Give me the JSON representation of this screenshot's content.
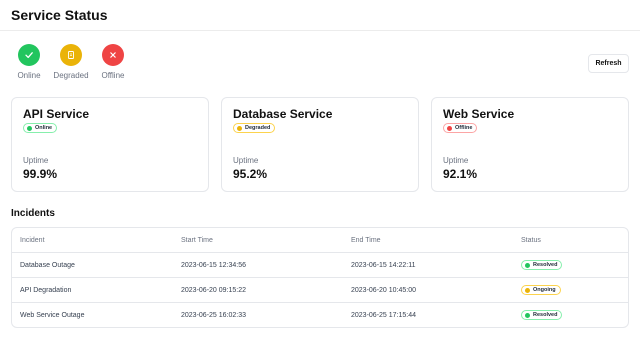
{
  "page": {
    "title": "Service Status"
  },
  "legend": [
    {
      "label": "Online",
      "icon": "check-icon",
      "color": "#22c55e",
      "glyph": "✓"
    },
    {
      "label": "Degraded",
      "icon": "document-icon",
      "color": "#eab308",
      "glyph": ""
    },
    {
      "label": "Offline",
      "icon": "x-icon",
      "color": "#ef4444",
      "glyph": "✕"
    }
  ],
  "toolbar": {
    "refresh_label": "Refresh"
  },
  "services": [
    {
      "name": "API Service",
      "status": "Online",
      "status_color": "#22c55e",
      "uptime_label": "Uptime",
      "uptime": "99.9%"
    },
    {
      "name": "Database Service",
      "status": "Degraded",
      "status_color": "#eab308",
      "uptime_label": "Uptime",
      "uptime": "95.2%"
    },
    {
      "name": "Web Service",
      "status": "Offline",
      "status_color": "#ef4444",
      "uptime_label": "Uptime",
      "uptime": "92.1%"
    }
  ],
  "incidents": {
    "title": "Incidents",
    "columns": [
      "Incident",
      "Start Time",
      "End Time",
      "Status"
    ],
    "rows": [
      {
        "incident": "Database Outage",
        "start": "2023-06-15 12:34:56",
        "end": "2023-06-15 14:22:11",
        "status": "Resolved",
        "status_color": "#22c55e"
      },
      {
        "incident": "API Degradation",
        "start": "2023-06-20 09:15:22",
        "end": "2023-06-20 10:45:00",
        "status": "Ongoing",
        "status_color": "#eab308"
      },
      {
        "incident": "Web Service Outage",
        "start": "2023-06-25 16:02:33",
        "end": "2023-06-25 17:15:44",
        "status": "Resolved",
        "status_color": "#22c55e"
      }
    ]
  }
}
